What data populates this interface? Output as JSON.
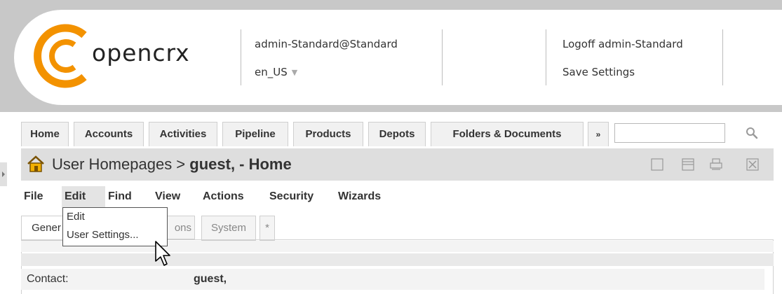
{
  "header": {
    "logo_text": "opencrx",
    "user": "admin-Standard@Standard",
    "locale": "en_US",
    "logoff": "Logoff admin-Standard",
    "save_settings": "Save Settings"
  },
  "nav": {
    "tabs": [
      "Home",
      "Accounts",
      "Activities",
      "Pipeline",
      "Products",
      "Depots",
      "Folders & Documents"
    ],
    "more": "»",
    "search_value": ""
  },
  "title": {
    "prefix": "User Homepages > ",
    "name": "guest, - Home"
  },
  "menu": {
    "items": [
      "File",
      "Edit",
      "Find",
      "View",
      "Actions",
      "Security",
      "Wizards"
    ],
    "active": "Edit"
  },
  "dropdown": {
    "items": [
      "Edit",
      "User Settings..."
    ]
  },
  "subtabs": {
    "general": "Gener",
    "hidden": "ons",
    "system": "System",
    "star": "*"
  },
  "form": {
    "contact_label": "Contact:",
    "contact_value": "guest,"
  },
  "colors": {
    "logo_orange": "#f39200",
    "header_band": "#c8c8c8",
    "title_bar": "#dedede"
  }
}
